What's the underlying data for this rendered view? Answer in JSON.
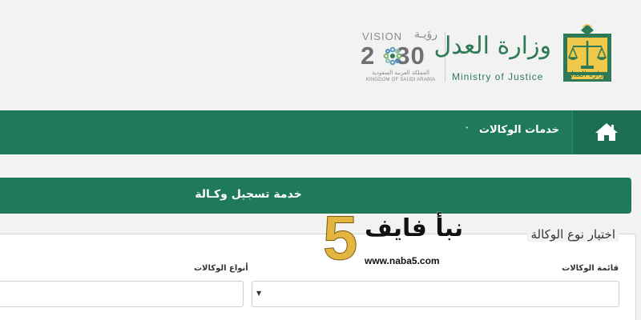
{
  "header": {
    "vision_logo": {
      "word_en": "VISION",
      "word_ar": "رؤيـة",
      "year_left": "2",
      "year_right": "30",
      "name_ar": "المملكة العربية السعودية",
      "name_en": "KINGDOM OF SAUDI ARABIA"
    },
    "ministry_logo": {
      "name_ar": "وزارة العدل",
      "name_en": "Ministry of Justice",
      "emblem_icon": "scales-of-justice-icon",
      "emblem_text": "وزارة العدل"
    }
  },
  "nav": {
    "home_icon": "home-icon",
    "menu_label": "خدمات الوكالات",
    "menu_chevron": "˅"
  },
  "service": {
    "title": "خدمة تسجيل وكـالة"
  },
  "form": {
    "section_title": "اختيار نوع الوكالة",
    "list_label": "قائمة الوكالات",
    "types_label": "أنواع الوكالات",
    "select_arrow": "▼"
  },
  "watermark": {
    "digit": "5",
    "name_ar": "نبأ فايف",
    "url": "www.naba5.com"
  },
  "colors": {
    "primary_green": "#1f7a5a",
    "home_green": "#1b6e51",
    "logo_green": "#2f7a56",
    "gold": "#e2b640",
    "background": "#f2f2f2"
  }
}
